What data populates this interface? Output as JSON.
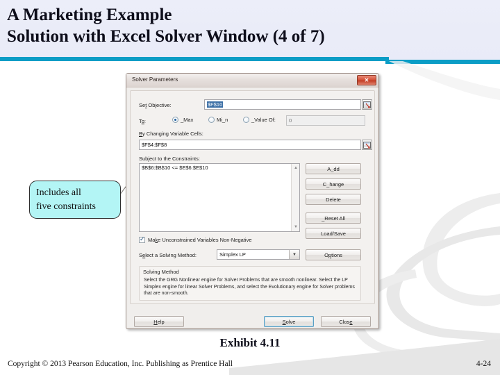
{
  "slide": {
    "title_line1": "A Marketing Example",
    "title_line2": "Solution with Excel Solver Window (4 of 7)",
    "accent_color": "#0b9dc6",
    "header_bg": "#eceef9"
  },
  "callout": {
    "line1": "Includes all",
    "line2": "five constraints",
    "fill_color": "#b3f5f5",
    "border_color": "#2d2d2d"
  },
  "dialog": {
    "title": "Solver Parameters",
    "close_label": "✕",
    "set_objective": {
      "label": "Se_t Objective:",
      "value": "$F$10",
      "picker_icon": "range-picker-icon"
    },
    "to_row": {
      "label": "T_o:",
      "options": [
        {
          "label": "_Max",
          "selected": true
        },
        {
          "label": "Mi_n",
          "selected": false
        },
        {
          "label": "_Value Of:",
          "selected": false
        }
      ],
      "value_of_field": "0"
    },
    "changing_cells": {
      "label": "_By Changing Variable Cells:",
      "value": "$F$4:$F$8",
      "picker_icon": "range-picker-icon"
    },
    "constraints": {
      "label": "Subject to the Constraints:",
      "items": [
        "$B$6:$B$10 <=  $E$6:$E$10"
      ],
      "scroll_up_icon": "chevron-up-icon",
      "scroll_down_icon": "chevron-down-icon"
    },
    "constraint_buttons": [
      {
        "name": "add",
        "label": "A_dd"
      },
      {
        "name": "change",
        "label": "C_hange"
      },
      {
        "name": "delete",
        "label": "Delete"
      },
      {
        "name": "reset-all",
        "label": "_Reset All"
      },
      {
        "name": "load-save",
        "label": "Load/Save"
      }
    ],
    "non_negative": {
      "label": "Ma_ke Unconstrained Variables Non-Negative",
      "checked": true
    },
    "solving_method": {
      "label": "S_elect a Solving Method:",
      "value": "Simplex LP",
      "dropdown_icon": "chevron-down-icon",
      "options_button": "O_ptions"
    },
    "method_group": {
      "title": "Solving Method",
      "description": "Select the GRG Nonlinear engine for Solver Problems that are smooth nonlinear.  Select the LP Simplex engine for linear Solver Problems, and select the Evolutionary engine for Solver problems that are non-smooth."
    },
    "footer_buttons": [
      {
        "name": "help",
        "label": "_Help",
        "default": false
      },
      {
        "name": "solve",
        "label": "_Solve",
        "default": true
      },
      {
        "name": "close",
        "label": "Clos_e",
        "default": false
      }
    ]
  },
  "footer": {
    "exhibit": "Exhibit 4.11",
    "copyright": "Copyright © 2013 Pearson Education, Inc. Publishing as Prentice Hall",
    "page_number": "4-24"
  }
}
